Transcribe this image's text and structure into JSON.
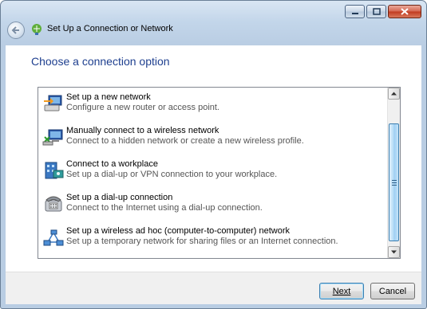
{
  "window": {
    "title": "Set Up a Connection or Network",
    "caption_buttons": [
      "minimize-icon",
      "maximize-icon",
      "close-icon"
    ]
  },
  "main": {
    "heading": "Choose a connection option",
    "options": [
      {
        "title": "Set up a new network",
        "description": "Configure a new router or access point.",
        "icon": "router-network-icon"
      },
      {
        "title": "Manually connect to a wireless network",
        "description": "Connect to a hidden network or create a new wireless profile.",
        "icon": "wireless-network-icon"
      },
      {
        "title": "Connect to a workplace",
        "description": "Set up a dial-up or VPN connection to your workplace.",
        "icon": "workplace-vpn-icon"
      },
      {
        "title": "Set up a dial-up connection",
        "description": "Connect to the Internet using a dial-up connection.",
        "icon": "dialup-phone-icon"
      },
      {
        "title": "Set up a wireless ad hoc (computer-to-computer) network",
        "description": "Set up a temporary network for sharing files or an Internet connection.",
        "icon": "adhoc-network-icon"
      }
    ]
  },
  "footer": {
    "next_label": "Next",
    "cancel_label": "Cancel"
  },
  "colors": {
    "heading": "#1e3f8f",
    "scroll_thumb": "#9ccdf3"
  }
}
